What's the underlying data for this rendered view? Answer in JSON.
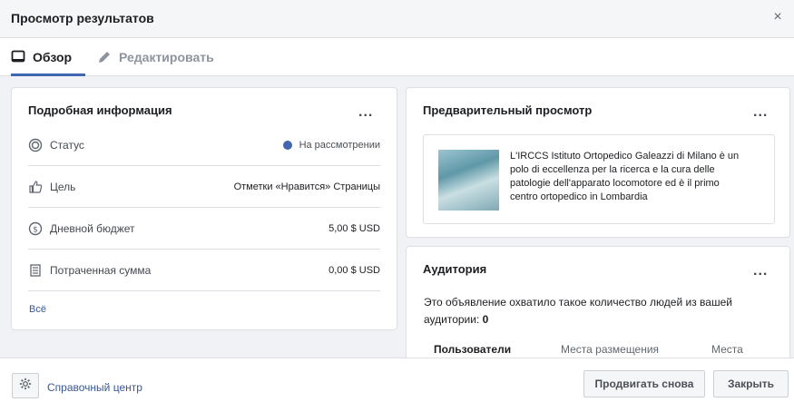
{
  "header": {
    "title": "Просмотр результатов",
    "close_label": "×"
  },
  "tabs": [
    {
      "label": "Обзор",
      "icon": "monitor-icon",
      "active": true
    },
    {
      "label": "Редактировать",
      "icon": "pencil-icon",
      "active": false
    }
  ],
  "details": {
    "title": "Подробная информация",
    "more_label": "...",
    "rows": [
      {
        "icon": "status-icon",
        "label": "Статус",
        "value": "На рассмотрении",
        "status_color": "#4267b2"
      },
      {
        "icon": "thumbs-up-icon",
        "label": "Цель",
        "value": "Отметки «Нравится» Страницы"
      },
      {
        "icon": "dollar-icon",
        "label": "Дневной бюджет",
        "value": "5,00 $ USD"
      },
      {
        "icon": "receipt-icon",
        "label": "Потраченная сумма",
        "value": "0,00 $ USD"
      }
    ],
    "see_all": "Всё"
  },
  "preview": {
    "title": "Предварительный просмотр",
    "more_label": "...",
    "ad_text": "L'IRCCS Istituto Ortopedico Galeazzi di Milano è un polo di eccellenza per la ricerca e la cura delle patologie dell'apparato locomotore ed è il primo centro ortopedico in Lombardia"
  },
  "audience": {
    "title": "Аудитория",
    "more_label": "...",
    "description": "Это объявление охватило такое количество людей из вашей аудитории:",
    "count": "0",
    "tabs": [
      "Пользователи",
      "Места размещения",
      "Места"
    ]
  },
  "footer": {
    "help_label": "Справочный центр",
    "promote_label": "Продвигать снова",
    "close_label": "Закрыть"
  },
  "colors": {
    "accent": "#4267b2",
    "link": "#385898"
  }
}
